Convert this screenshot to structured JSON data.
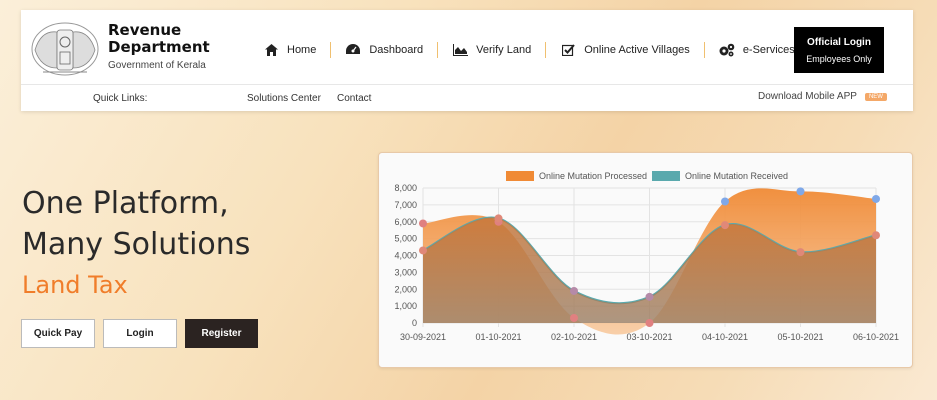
{
  "brand": {
    "title_line1": "Revenue",
    "title_line2": "Department",
    "subtitle": "Government of Kerala"
  },
  "nav": [
    {
      "label": "Home",
      "icon": "home-icon"
    },
    {
      "label": "Dashboard",
      "icon": "dashboard-icon"
    },
    {
      "label": "Verify Land",
      "icon": "area-chart-icon"
    },
    {
      "label": "Online Active Villages",
      "icon": "checkbox-icon"
    },
    {
      "label": "e-Services",
      "icon": "cogs-icon"
    }
  ],
  "official_login": {
    "line1": "Official Login",
    "line2": "Employees Only"
  },
  "quick_links": {
    "label": "Quick Links:",
    "links": [
      "Solutions Center",
      "Contact"
    ],
    "download": "Download Mobile APP",
    "badge": "NEW"
  },
  "hero": {
    "title_line1": "One Platform,",
    "title_line2": "Many Solutions",
    "subtitle": "Land Tax",
    "buttons": [
      "Quick Pay",
      "Login",
      "Register"
    ]
  },
  "colors": {
    "accent": "#f07d2a",
    "processed": "#f08a35",
    "received": "#5aa9ad",
    "dark_button": "#2b2321"
  },
  "chart_data": {
    "type": "area",
    "categories": [
      "30-09-2021",
      "01-10-2021",
      "02-10-2021",
      "03-10-2021",
      "04-10-2021",
      "05-10-2021",
      "06-10-2021"
    ],
    "series": [
      {
        "name": "Online Mutation Processed",
        "color": "#f08a35",
        "values": [
          5900,
          6000,
          300,
          0,
          7200,
          7800,
          7350
        ]
      },
      {
        "name": "Online Mutation Received",
        "color": "#5aa9ad",
        "values": [
          4300,
          6200,
          1900,
          1550,
          5800,
          4200,
          5200
        ]
      }
    ],
    "ylim": [
      0,
      8000
    ],
    "yticks": [
      "0",
      "1,000",
      "2,000",
      "3,000",
      "4,000",
      "5,000",
      "6,000",
      "7,000",
      "8,000"
    ],
    "grid": true,
    "legend": "top"
  }
}
